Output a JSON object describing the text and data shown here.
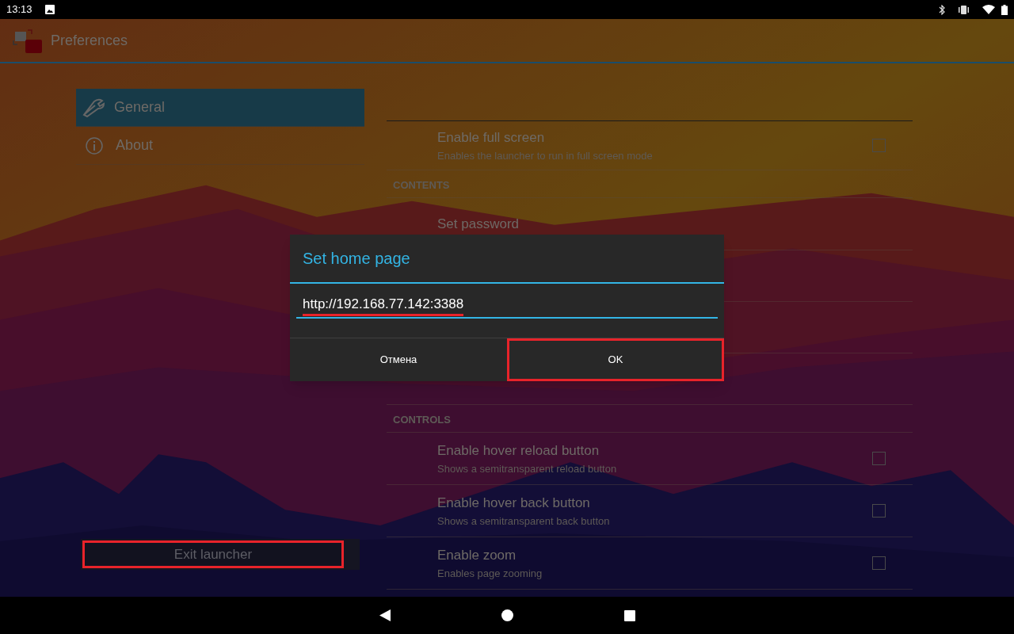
{
  "status_bar": {
    "time": "13:13"
  },
  "app_bar": {
    "title": "Preferences"
  },
  "sidebar": {
    "items": [
      {
        "label": "General",
        "kind": "wrench",
        "selected": true
      },
      {
        "label": "About",
        "kind": "info",
        "selected": false
      }
    ],
    "exit_button": {
      "label": "Exit launcher",
      "highlighted": true
    }
  },
  "settings": [
    {
      "kind": "row",
      "title": "Enable full screen",
      "subtitle": "Enables the launcher to run in full screen mode",
      "checked": false
    },
    {
      "kind": "header",
      "title": "CONTENTS"
    },
    {
      "kind": "row",
      "title": "Set password"
    },
    {
      "kind": "hidden"
    },
    {
      "kind": "hidden"
    },
    {
      "kind": "hidden"
    },
    {
      "kind": "header",
      "title": "CONTROLS"
    },
    {
      "kind": "row",
      "title": "Enable hover reload button",
      "subtitle": "Shows a semitransparent reload button",
      "checked": false
    },
    {
      "kind": "row",
      "title": "Enable hover back button",
      "subtitle": "Shows a semitransparent back button",
      "checked": false
    },
    {
      "kind": "row",
      "title": "Enable zoom",
      "subtitle": "Enables page zooming",
      "checked": false
    }
  ],
  "dialog": {
    "title": "Set home page",
    "value": "http://192.168.77.142:3388",
    "value_underlined": true,
    "buttons": [
      {
        "label": "Отмена",
        "highlighted": false
      },
      {
        "label": "OK",
        "highlighted": true
      }
    ]
  }
}
